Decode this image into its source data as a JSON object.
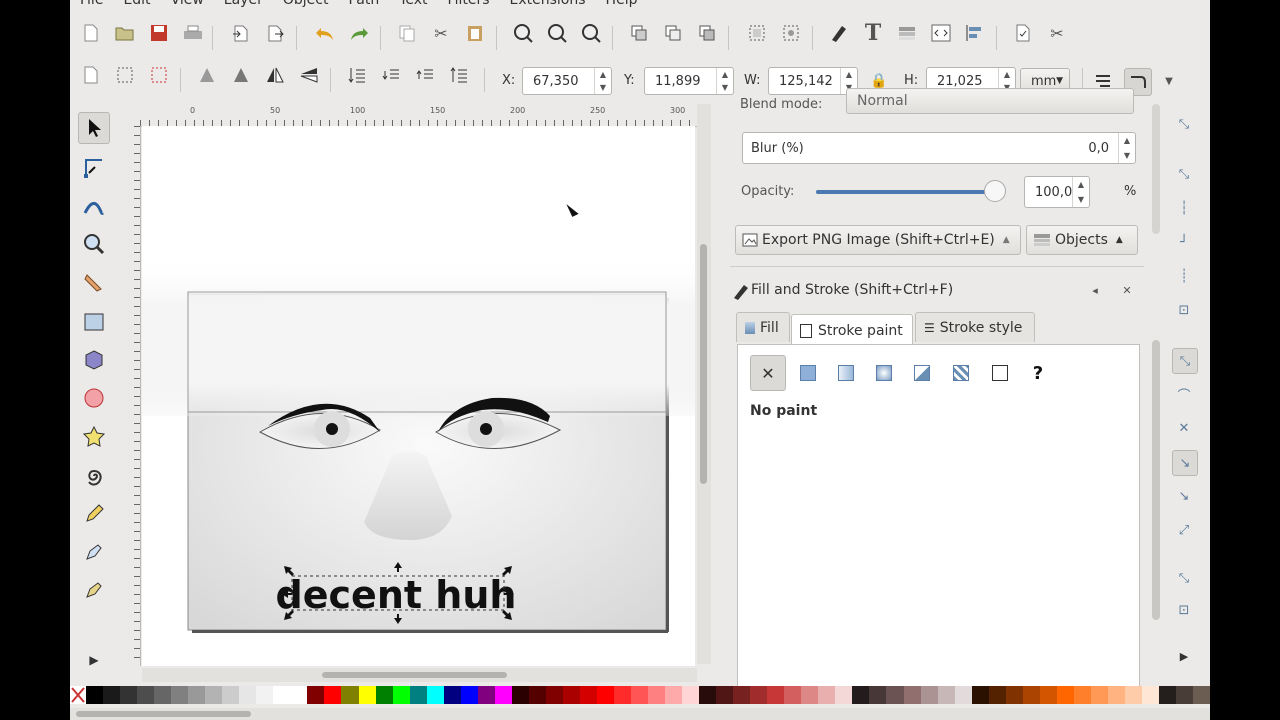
{
  "menu": [
    "File",
    "Edit",
    "View",
    "Layer",
    "Object",
    "Path",
    "Text",
    "Filters",
    "Extensions",
    "Help"
  ],
  "toolbar_icons": [
    "new-icon",
    "open-icon",
    "save-icon",
    "print-icon",
    "import-icon",
    "export-icon",
    "undo-icon",
    "redo-icon",
    "copy-icon",
    "cut-icon",
    "paste-icon",
    "zoom-selection-icon",
    "zoom-drawing-icon",
    "zoom-page-icon",
    "duplicate-icon",
    "clone-icon",
    "unlink-clone-icon",
    "group-icon",
    "ungroup-icon",
    "fill-stroke-icon",
    "text-icon",
    "layers-icon",
    "xml-editor-icon",
    "align-icon",
    "document-props-icon",
    "preferences-icon"
  ],
  "coords": {
    "x_label": "X:",
    "x_value": "67,350",
    "y_label": "Y:",
    "y_value": "11,899",
    "w_label": "W:",
    "w_value": "125,142",
    "h_label": "H:",
    "h_value": "21,025",
    "unit": "mm"
  },
  "ruler": {
    "h": [
      "0",
      "50",
      "100",
      "150",
      "200",
      "250",
      "300"
    ]
  },
  "dock": {
    "blend_mode_label": "Blend mode:",
    "blend_mode_value": "Normal",
    "blur_label": "Blur (%)",
    "blur_value": "0,0",
    "opacity_label": "Opacity:",
    "opacity_value": "100,0",
    "opacity_unit": "%",
    "opacity_level": 1.0,
    "export_button": "Export PNG Image (Shift+Ctrl+E)",
    "objects_button": "Objects",
    "fill_stroke_title": "Fill and Stroke (Shift+Ctrl+F)",
    "tabs": [
      "Fill",
      "Stroke paint",
      "Stroke style"
    ],
    "active_tab": "Stroke paint",
    "paint_status": "No paint",
    "unknown_paint": "?"
  },
  "canvas": {
    "text": "decent huh"
  },
  "palette": [
    "#000000",
    "#1a1a1a",
    "#333333",
    "#4d4d4d",
    "#666666",
    "#808080",
    "#999999",
    "#b3b3b3",
    "#cccccc",
    "#e6e6e6",
    "#f2f2f2",
    "#ffffff",
    "#ffffff",
    "#800000",
    "#ff0000",
    "#808000",
    "#ffff00",
    "#008000",
    "#00ff00",
    "#008080",
    "#00ffff",
    "#000080",
    "#0000ff",
    "#800080",
    "#ff00ff",
    "#2b0000",
    "#550000",
    "#800000",
    "#aa0000",
    "#d40000",
    "#ff0000",
    "#ff2a2a",
    "#ff5555",
    "#ff8080",
    "#ffaaaa",
    "#ffd5d5",
    "#280b0b",
    "#501616",
    "#782121",
    "#a02c2c",
    "#c83737",
    "#d35f5f",
    "#de8787",
    "#e9afaf",
    "#f4d7d7",
    "#241c1c",
    "#483737",
    "#6c5353",
    "#916f6f",
    "#ac9393",
    "#c8b7b7",
    "#e3dbdb",
    "#2b1100",
    "#552200",
    "#803300",
    "#aa4400",
    "#d45500",
    "#ff6600",
    "#ff7f2a",
    "#ff9955",
    "#ffb380",
    "#ffccaa",
    "#ffe6d5",
    "#241f1c",
    "#483e37",
    "#6c5d53"
  ]
}
